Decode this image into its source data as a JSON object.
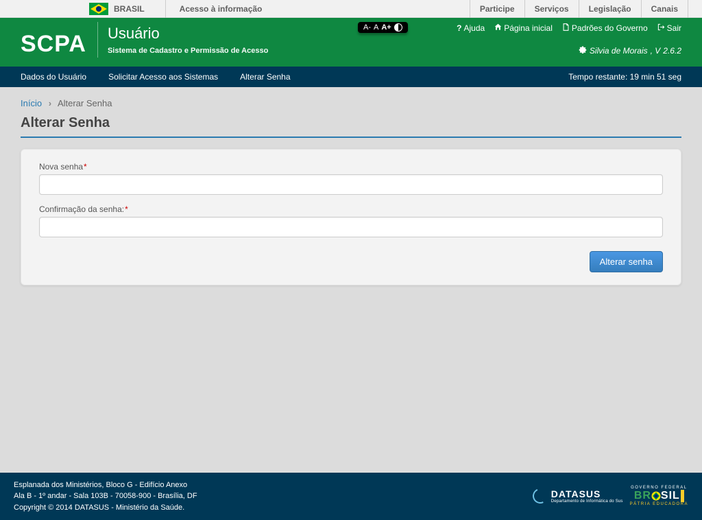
{
  "govbar": {
    "brasil": "BRASIL",
    "info": "Acesso à informação",
    "links": [
      "Participe",
      "Serviços",
      "Legislação",
      "Canais"
    ]
  },
  "header": {
    "logo": "SCPA",
    "title": "Usuário",
    "subtitle": "Sistema de Cadastro e Permissão de Acesso",
    "font_dec": "A-",
    "font_def": "A",
    "font_inc": "A+",
    "links": {
      "ajuda": "Ajuda",
      "pagina_inicial": "Página inicial",
      "padroes": "Padrões do Governo",
      "sair": "Sair"
    },
    "user_name": "Silvia de Morais",
    "version_prefix": ", V",
    "version": "2.6.2"
  },
  "menu": {
    "items": [
      "Dados do Usuário",
      "Solicitar Acesso aos Sistemas",
      "Alterar Senha"
    ],
    "timer": "Tempo restante: 19 min 51 seg"
  },
  "breadcrumb": {
    "home": "Início",
    "current": "Alterar Senha"
  },
  "page": {
    "title": "Alterar Senha",
    "labels": {
      "nova_senha": "Nova senha",
      "confirmacao": "Confirmação da senha:"
    },
    "button": "Alterar senha"
  },
  "footer": {
    "line1": "Esplanada dos Ministérios, Bloco G - Edifício Anexo",
    "line2": "Ala B - 1º andar - Sala 103B - 70058-900 - Brasília, DF",
    "line3": "Copyright © 2014 DATASUS - Ministério da Saúde.",
    "datasus": "DATASUS",
    "datasus_sub": "Departamento de Informática do Sus",
    "gov_top": "GOVERNO FEDERAL",
    "gov_mid_left": "BR",
    "gov_mid_right": "SIL",
    "gov_bot": "PÁTRIA EDUCADORA"
  }
}
